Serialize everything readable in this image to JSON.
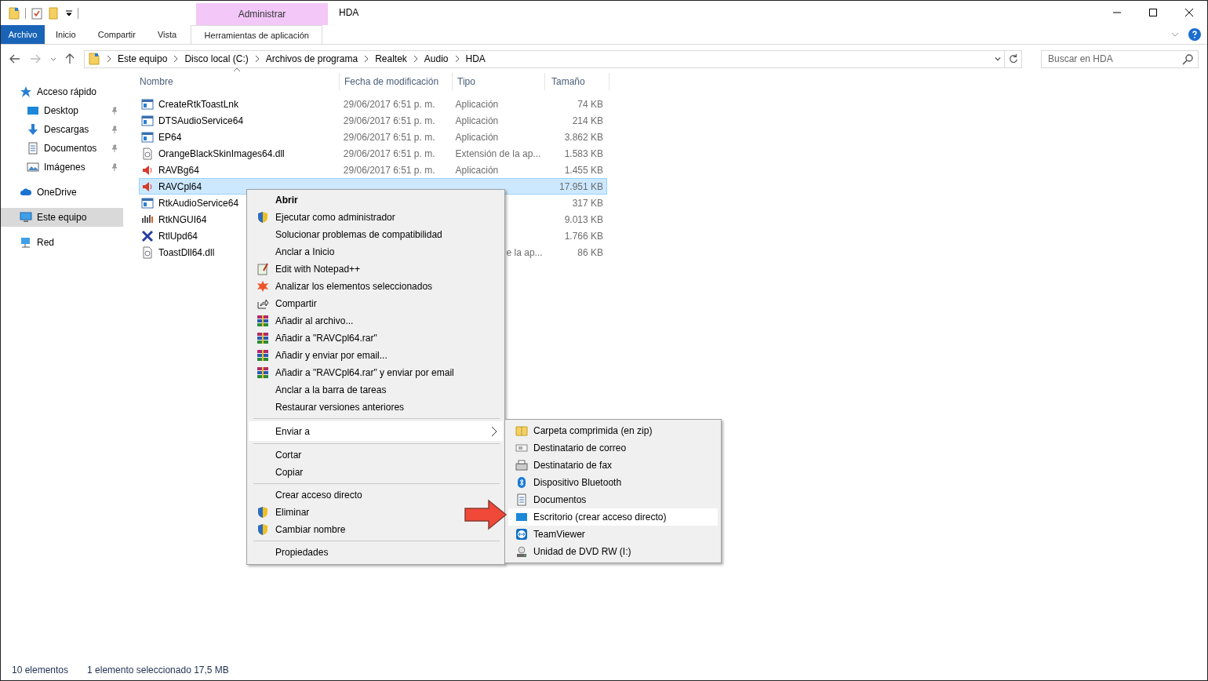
{
  "window": {
    "title": "HDA",
    "context_tab": "Administrar"
  },
  "ribbon": {
    "tabs": [
      {
        "label": "Archivo",
        "kind": "file"
      },
      {
        "label": "Inicio",
        "kind": "tab"
      },
      {
        "label": "Compartir",
        "kind": "tab"
      },
      {
        "label": "Vista",
        "kind": "tab"
      },
      {
        "label": "Herramientas de aplicación",
        "kind": "context"
      }
    ]
  },
  "address": {
    "crumbs": [
      "Este equipo",
      "Disco local (C:)",
      "Archivos de programa",
      "Realtek",
      "Audio",
      "HDA"
    ]
  },
  "search": {
    "placeholder": "Buscar en HDA"
  },
  "sidebar": {
    "items": [
      {
        "label": "Acceso rápido",
        "selected": false,
        "children": [
          {
            "label": "Desktop",
            "selected": false,
            "pinned": true
          },
          {
            "label": "Descargas",
            "selected": false,
            "pinned": true
          },
          {
            "label": "Documentos",
            "selected": false,
            "pinned": true
          },
          {
            "label": "Imágenes",
            "selected": false,
            "pinned": true
          }
        ]
      },
      {
        "label": "OneDrive",
        "selected": false
      },
      {
        "label": "Este equipo",
        "selected": true
      },
      {
        "label": "Red",
        "selected": false
      }
    ]
  },
  "table": {
    "columns": [
      "Nombre",
      "Fecha de modificación",
      "Tipo",
      "Tamaño"
    ],
    "rows": [
      {
        "name": "CreateRtkToastLnk",
        "date": "29/06/2017 6:51 p. m.",
        "type": "Aplicación",
        "size": "74 KB",
        "selected": false
      },
      {
        "name": "DTSAudioService64",
        "date": "29/06/2017 6:51 p. m.",
        "type": "Aplicación",
        "size": "214 KB",
        "selected": false
      },
      {
        "name": "EP64",
        "date": "29/06/2017 6:51 p. m.",
        "type": "Aplicación",
        "size": "3.862 KB",
        "selected": false
      },
      {
        "name": "OrangeBlackSkinImages64.dll",
        "date": "29/06/2017 6:51 p. m.",
        "type": "Extensión de la ap...",
        "size": "1.583 KB",
        "selected": false
      },
      {
        "name": "RAVBg64",
        "date": "29/06/2017 6:51 p. m.",
        "type": "Aplicación",
        "size": "1.455 KB",
        "selected": false
      },
      {
        "name": "RAVCpl64",
        "size": "17.951 KB",
        "selected": true
      },
      {
        "name": "RtkAudioService64",
        "size": "317 KB",
        "selected": false
      },
      {
        "name": "RtkNGUI64",
        "size": "9.013 KB",
        "selected": false
      },
      {
        "name": "RtlUpd64",
        "size": "1.766 KB",
        "selected": false
      },
      {
        "name": "ToastDll64.dll",
        "type": "e la ap...",
        "size": "86 KB",
        "selected": false
      }
    ]
  },
  "context_menu": {
    "items": [
      {
        "kind": "item",
        "label": "Abrir",
        "default": true
      },
      {
        "kind": "item",
        "label": "Ejecutar como administrador"
      },
      {
        "kind": "item",
        "label": "Solucionar problemas de compatibilidad"
      },
      {
        "kind": "item",
        "label": "Anclar a Inicio"
      },
      {
        "kind": "item",
        "label": "Edit with Notepad++"
      },
      {
        "kind": "item",
        "label": "Analizar los elementos seleccionados"
      },
      {
        "kind": "item",
        "label": "Compartir"
      },
      {
        "kind": "item",
        "label": "Añadir al archivo..."
      },
      {
        "kind": "item",
        "label": "Añadir a \"RAVCpl64.rar\""
      },
      {
        "kind": "item",
        "label": "Añadir y enviar por email..."
      },
      {
        "kind": "item",
        "label": "Añadir a \"RAVCpl64.rar\" y enviar por email"
      },
      {
        "kind": "item",
        "label": "Anclar a la barra de tareas"
      },
      {
        "kind": "item",
        "label": "Restaurar versiones anteriores"
      },
      {
        "kind": "separator"
      },
      {
        "kind": "submenu",
        "label": "Enviar a",
        "selected": true
      },
      {
        "kind": "separator"
      },
      {
        "kind": "item",
        "label": "Cortar"
      },
      {
        "kind": "item",
        "label": "Copiar"
      },
      {
        "kind": "separator"
      },
      {
        "kind": "item",
        "label": "Crear acceso directo"
      },
      {
        "kind": "item",
        "label": "Eliminar"
      },
      {
        "kind": "item",
        "label": "Cambiar nombre"
      },
      {
        "kind": "separator"
      },
      {
        "kind": "item",
        "label": "Propiedades"
      }
    ]
  },
  "send_to_menu": {
    "items": [
      {
        "label": "Carpeta comprimida (en zip)",
        "selected": false
      },
      {
        "label": "Destinatario de correo",
        "selected": false
      },
      {
        "label": "Destinatario de fax",
        "selected": false
      },
      {
        "label": "Dispositivo Bluetooth",
        "selected": false
      },
      {
        "label": "Documentos",
        "selected": false
      },
      {
        "label": "Escritorio (crear acceso directo)",
        "selected": true
      },
      {
        "label": "TeamViewer",
        "selected": false
      },
      {
        "label": "Unidad de DVD RW (I:)",
        "selected": false
      }
    ]
  },
  "status_bar": {
    "count": "10 elementos",
    "selection": "1 elemento seleccionado  17,5 MB"
  }
}
